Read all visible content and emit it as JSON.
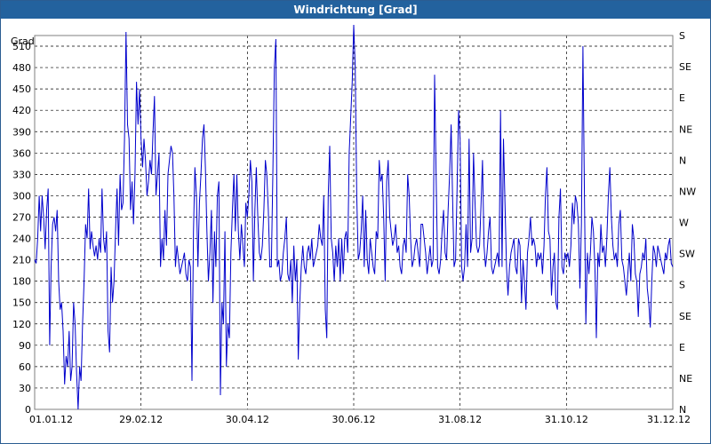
{
  "window": {
    "title": "Windrichtung [Grad]"
  },
  "chart_data": {
    "type": "line",
    "title": "Windrichtung [Grad]",
    "ylabel": "Grad",
    "ylim": [
      0,
      525
    ],
    "yticks": [
      0,
      30,
      60,
      90,
      120,
      150,
      180,
      210,
      240,
      270,
      300,
      330,
      360,
      390,
      420,
      450,
      480,
      510
    ],
    "y2ticks": [
      "N",
      "NE",
      "E",
      "SE",
      "S",
      "SW",
      "W",
      "NW",
      "N",
      "NE",
      "E",
      "SE",
      "S"
    ],
    "xticks": [
      "01.01.12",
      "29.02.12",
      "30.04.12",
      "30.06.12",
      "31.08.12",
      "31.10.12",
      "31.12.12"
    ],
    "grid": true,
    "series": [
      {
        "color": "#0000cc",
        "values": [
          210,
          205,
          240,
          300,
          250,
          300,
          270,
          225,
          280,
          310,
          90,
          200,
          260,
          270,
          250,
          280,
          180,
          140,
          150,
          110,
          35,
          75,
          60,
          110,
          40,
          60,
          150,
          120,
          50,
          0,
          60,
          40,
          120,
          180,
          260,
          240,
          310,
          225,
          250,
          230,
          215,
          230,
          210,
          240,
          220,
          310,
          240,
          220,
          250,
          110,
          80,
          200,
          150,
          180,
          250,
          310,
          230,
          330,
          280,
          290,
          380,
          530,
          400,
          380,
          280,
          320,
          260,
          330,
          460,
          400,
          450,
          380,
          340,
          380,
          350,
          300,
          320,
          350,
          330,
          390,
          440,
          300,
          330,
          360,
          200,
          240,
          210,
          280,
          230,
          330,
          350,
          370,
          360,
          300,
          200,
          230,
          210,
          190,
          200,
          210,
          220,
          190,
          180,
          210,
          200,
          40,
          250,
          340,
          300,
          200,
          290,
          330,
          380,
          400,
          340,
          250,
          180,
          220,
          280,
          150,
          250,
          200,
          300,
          320,
          20,
          150,
          120,
          250,
          60,
          120,
          100,
          220,
          280,
          330,
          250,
          330,
          250,
          210,
          260,
          230,
          200,
          290,
          270,
          300,
          350,
          320,
          180,
          280,
          340,
          270,
          220,
          210,
          230,
          280,
          350,
          330,
          280,
          200,
          200,
          330,
          480,
          520,
          200,
          210,
          180,
          190,
          220,
          240,
          270,
          190,
          180,
          210,
          150,
          230,
          180,
          210,
          70,
          150,
          200,
          230,
          200,
          190,
          220,
          230,
          210,
          240,
          200,
          210,
          220,
          230,
          260,
          240,
          230,
          300,
          140,
          100,
          300,
          370,
          240,
          220,
          180,
          230,
          200,
          240,
          180,
          240,
          190,
          240,
          250,
          220,
          360,
          410,
          460,
          540,
          480,
          300,
          210,
          220,
          250,
          300,
          200,
          280,
          210,
          190,
          240,
          220,
          200,
          190,
          250,
          240,
          350,
          320,
          330,
          270,
          180,
          320,
          350,
          270,
          250,
          230,
          240,
          260,
          220,
          230,
          200,
          190,
          230,
          240,
          220,
          330,
          300,
          240,
          200,
          210,
          230,
          240,
          220,
          200,
          260,
          260,
          240,
          220,
          190,
          210,
          230,
          200,
          210,
          470,
          330,
          200,
          190,
          210,
          250,
          280,
          220,
          210,
          280,
          330,
          400,
          300,
          200,
          210,
          310,
          420,
          380,
          200,
          180,
          200,
          260,
          200,
          380,
          220,
          240,
          360,
          290,
          230,
          220,
          230,
          290,
          350,
          230,
          200,
          220,
          250,
          270,
          200,
          190,
          200,
          210,
          220,
          200,
          420,
          200,
          380,
          290,
          200,
          160,
          200,
          220,
          230,
          240,
          200,
          190,
          240,
          230,
          150,
          210,
          180,
          140,
          220,
          240,
          270,
          230,
          240,
          230,
          200,
          220,
          210,
          220,
          190,
          230,
          300,
          340,
          250,
          240,
          160,
          200,
          220,
          150,
          140,
          270,
          310,
          200,
          190,
          220,
          210,
          220,
          200,
          230,
          290,
          260,
          300,
          290,
          260,
          170,
          260,
          510,
          300,
          120,
          220,
          190,
          220,
          270,
          250,
          200,
          100,
          220,
          200,
          260,
          220,
          230,
          200,
          240,
          300,
          340,
          270,
          230,
          210,
          220,
          200,
          260,
          280,
          210,
          200,
          180,
          160,
          190,
          220,
          180,
          260,
          240,
          190,
          180,
          130,
          190,
          200,
          220,
          210,
          240,
          170,
          150,
          115,
          180,
          230,
          220,
          200,
          230,
          220,
          210,
          200,
          190,
          220,
          210,
          230,
          240,
          205,
          200
        ]
      }
    ]
  }
}
